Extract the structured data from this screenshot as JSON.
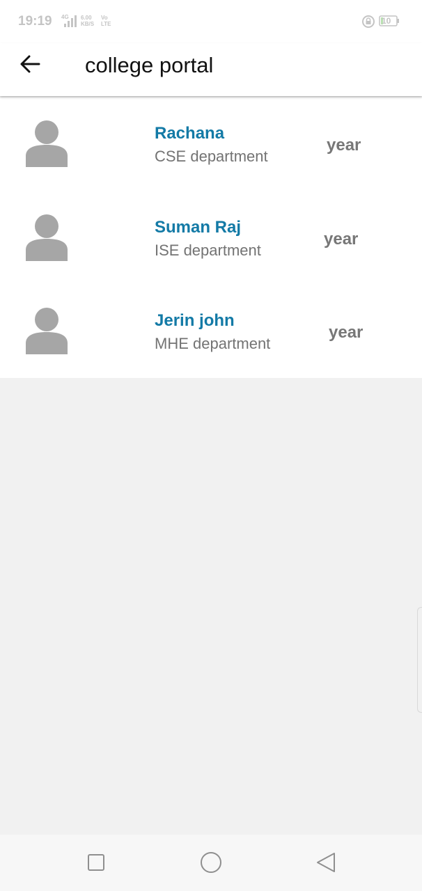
{
  "status_bar": {
    "time": "19:19",
    "network_small_top": "4G",
    "speed_value": "6.00",
    "speed_unit": "KB/S",
    "volte_top": "Vo",
    "volte_bottom": "LTE",
    "battery_level": "10",
    "icons": [
      "signal-icon",
      "lock-icon",
      "battery-icon"
    ]
  },
  "app_bar": {
    "title": "college portal",
    "back_icon": "arrow-left-icon"
  },
  "students": [
    {
      "name": "Rachana",
      "department": "CSE department",
      "year_label": "year"
    },
    {
      "name": "Suman Raj",
      "department": "ISE department",
      "year_label": "year"
    },
    {
      "name": "Jerin john",
      "department": "MHE department",
      "year_label": "year"
    }
  ],
  "nav_bar": {
    "icons": [
      "recent-apps-icon",
      "home-icon",
      "back-triangle-icon"
    ]
  },
  "colors": {
    "accent": "#137aa6",
    "secondary_text": "#737373",
    "background": "#f1f1f1",
    "avatar": "#a6a6a6"
  }
}
